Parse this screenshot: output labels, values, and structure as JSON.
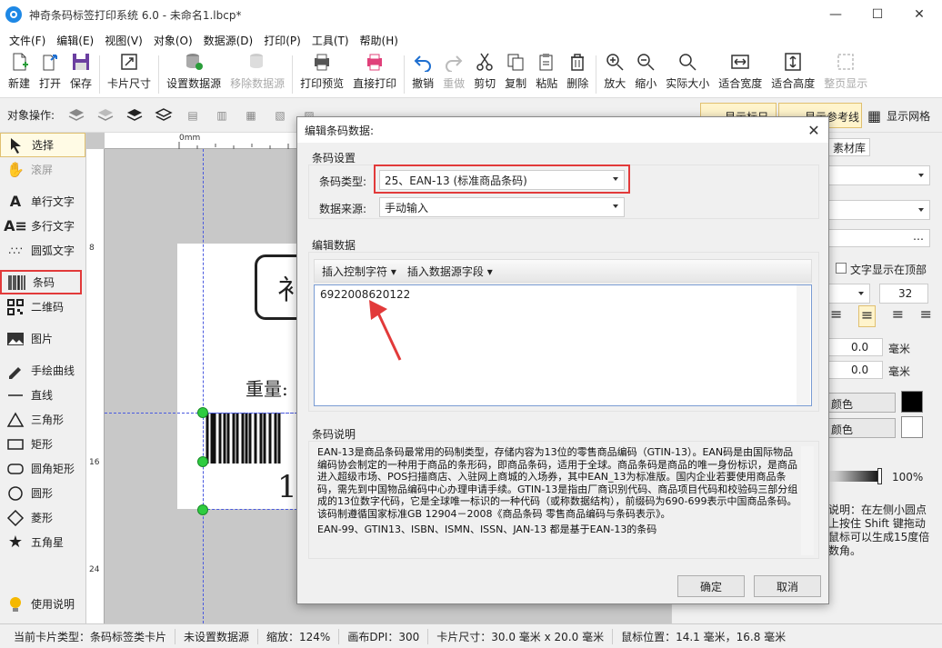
{
  "window": {
    "title": "神奇条码标签打印系统 6.0 - 未命名1.lbcp*"
  },
  "menu": [
    "文件(F)",
    "编辑(E)",
    "视图(V)",
    "对象(O)",
    "数据源(D)",
    "打印(P)",
    "工具(T)",
    "帮助(H)"
  ],
  "toolbar": {
    "new": "新建",
    "open": "打开",
    "save": "保存",
    "card_size": "卡片尺寸",
    "set_datasource": "设置数据源",
    "remove_datasource": "移除数据源",
    "print_preview": "打印预览",
    "direct_print": "直接打印",
    "undo": "撤销",
    "redo": "重做",
    "cut": "剪切",
    "copy": "复制",
    "paste": "粘贴",
    "delete": "删除",
    "zoom_in": "放大",
    "zoom_out": "缩小",
    "actual_size": "实际大小",
    "fit_width": "适合宽度",
    "fit_height": "适合高度",
    "full_page": "整页显示"
  },
  "toolbar2": {
    "label": "对象操作:",
    "show_ruler": "显示标尺",
    "show_guides": "显示参考线",
    "show_grid": "显示网格"
  },
  "tools": [
    "选择",
    "滚屏",
    "单行文字",
    "多行文字",
    "圆弧文字",
    "条码",
    "二维码",
    "图片",
    "手绘曲线",
    "直线",
    "三角形",
    "矩形",
    "圆角矩形",
    "圆形",
    "菱形",
    "五角星"
  ],
  "help_tool": "使用说明",
  "canvas": {
    "ruler_marks_top": [
      "0mm"
    ],
    "ruler_marks_left": [
      "8",
      "16",
      "24"
    ],
    "label_weight": "重量:",
    "label_digit": "1",
    "label_partial": "衤"
  },
  "right_panel": {
    "tab": "素材库",
    "text_on_top": "文字显示在顶部",
    "font_size": "32",
    "offset1": "0.0",
    "offset2": "0.0",
    "unit": "毫米",
    "color1_label": "颜色",
    "color2_label": "颜色",
    "opacity": "100%",
    "hint": "说明：在左侧小圆点上按住 Shift 键拖动鼠标可以生成15度倍数角。"
  },
  "status": {
    "card_type": "当前卡片类型：条码标签类卡片",
    "datasource": "未设置数据源",
    "zoom": "缩放：124%",
    "dpi": "画布DPI：300",
    "card_size": "卡片尺寸：30.0 毫米 x 20.0 毫米",
    "mouse_pos": "鼠标位置：14.1 毫米，16.8 毫米"
  },
  "dialog": {
    "title": "编辑条码数据:",
    "group_settings": "条码设置",
    "barcode_type_label": "条码类型:",
    "barcode_type_value": "25、EAN-13 (标准商品条码)",
    "data_source_label": "数据来源:",
    "data_source_value": "手动输入",
    "group_edit": "编辑数据",
    "insert_control": "插入控制字符",
    "insert_field": "插入数据源字段",
    "barcode_data": "6922008620122",
    "group_desc": "条码说明",
    "description": "EAN-13是商品条码最常用的码制类型，存储内容为13位的零售商品编码（GTIN-13）。EAN码是由国际物品编码协会制定的一种用于商品的条形码，即商品条码，适用于全球。商品条码是商品的唯一身份标识，是商品进入超级市场、POS扫描商店、入驻网上商城的入场券，其中EAN_13为标准版。国内企业若要使用商品条码，需先到中国物品编码中心办理申请手续。GTIN-13是指由厂商识别代码、商品项目代码和校验码三部分组成的13位数字代码，它是全球唯一标识的一种代码（或称数据结构），前缀码为690-699表示中国商品条码。该码制遵循国家标准GB 12904－2008《商品条码 零售商品编码与条码表示》。",
    "description2": "EAN-99、GTIN13、ISBN、ISMN、ISSN、JAN-13 都是基于EAN-13的条码",
    "ok": "确定",
    "cancel": "取消"
  }
}
